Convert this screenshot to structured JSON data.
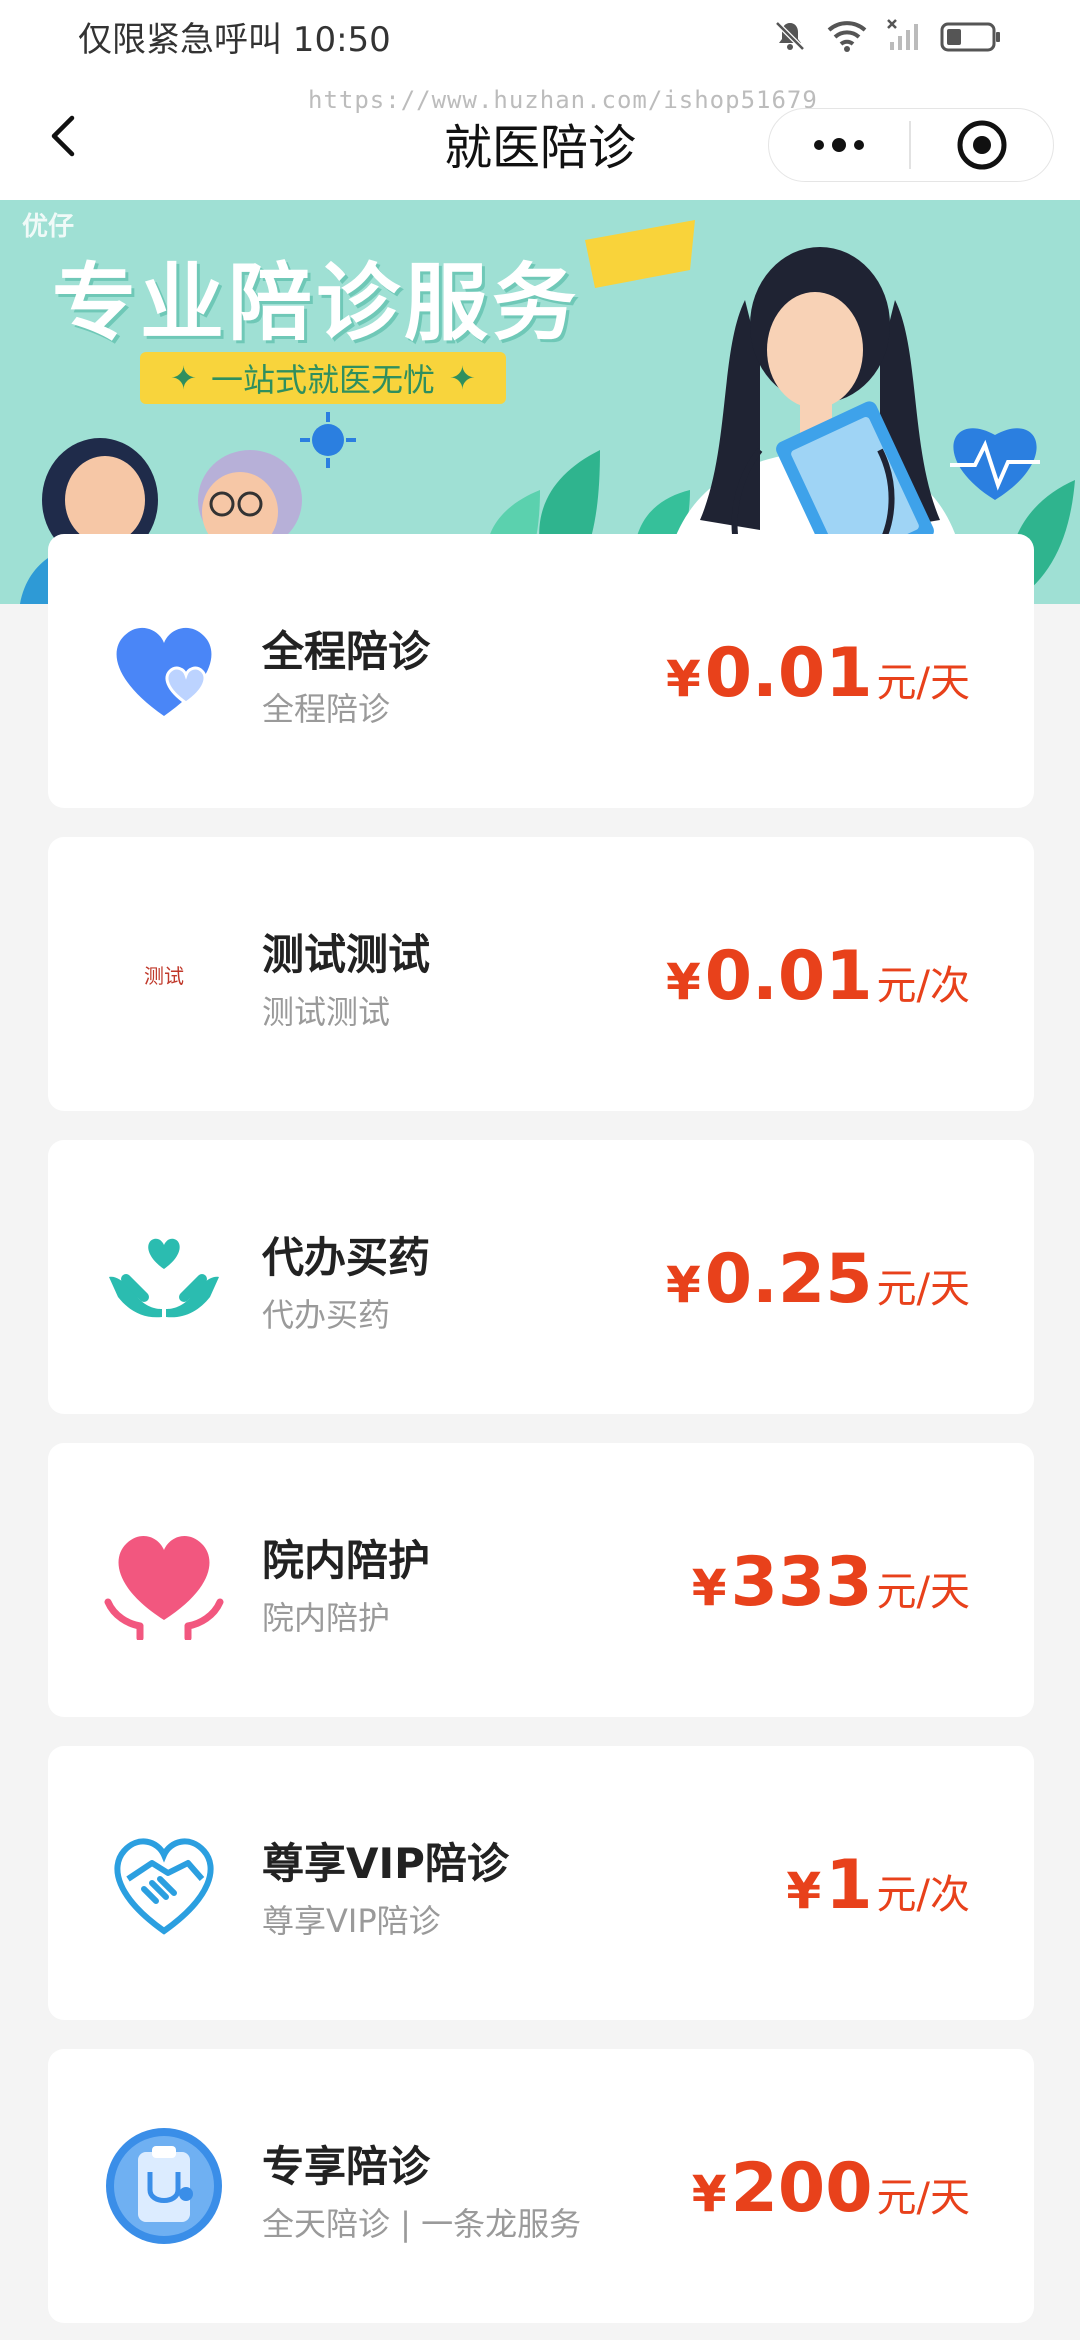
{
  "status_bar": {
    "left_text": "仅限紧急呼叫 10:50"
  },
  "nav": {
    "title": "就医陪诊",
    "watermark": "https://www.huzhan.com/ishop51679"
  },
  "banner": {
    "brand": "优仔",
    "headline": "专业陪诊服务",
    "pill_text": "一站式就医无忧"
  },
  "services": [
    {
      "title": "全程陪诊",
      "subtitle": "全程陪诊",
      "currency": "¥",
      "price": "0.01",
      "unit": "元/天",
      "icon": "heart-icon",
      "color": "#4a86f7"
    },
    {
      "title": "测试测试",
      "subtitle": "测试测试",
      "currency": "¥",
      "price": "0.01",
      "unit": "元/次",
      "icon": "test-image-icon",
      "icon_text": "测试"
    },
    {
      "title": "代办买药",
      "subtitle": "代办买药",
      "currency": "¥",
      "price": "0.25",
      "unit": "元/天",
      "icon": "hands-heart-icon",
      "color": "#2bbcb0"
    },
    {
      "title": "院内陪护",
      "subtitle": "院内陪护",
      "currency": "¥",
      "price": "333",
      "unit": "元/天",
      "icon": "heart-hands-icon",
      "color": "#f2577f"
    },
    {
      "title": "尊享VIP陪诊",
      "subtitle": "尊享VIP陪诊",
      "currency": "¥",
      "price": "1",
      "unit": "元/次",
      "icon": "handshake-heart-icon",
      "color": "#2b9fe0"
    },
    {
      "title": "专享陪诊",
      "subtitle": "全天陪诊 | 一条龙服务",
      "currency": "¥",
      "price": "200",
      "unit": "元/天",
      "icon": "clipboard-stethoscope-icon",
      "color": "#3a8ee8"
    }
  ],
  "colors": {
    "price": "#e8411b",
    "banner_bg": "#9fe0d4",
    "page_bg": "#f4f4f4"
  }
}
